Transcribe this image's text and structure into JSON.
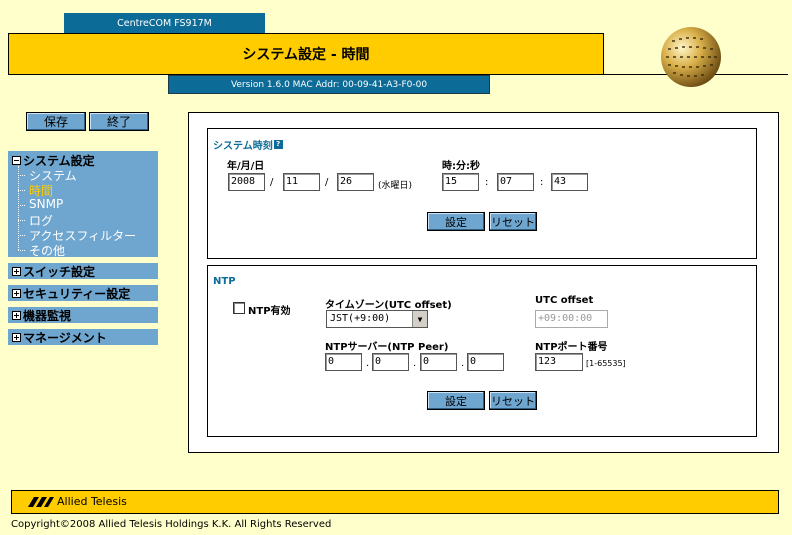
{
  "header": {
    "model": "CentreCOM FS917M",
    "title": "システム設定 - 時間",
    "version": "Version 1.6.0 MAC Addr: 00-09-41-A3-F0-00"
  },
  "sidebar": {
    "save_label": "保存",
    "exit_label": "終了",
    "system_settings": {
      "label": "システム設定",
      "items": [
        "システム",
        "時間",
        "SNMP",
        "ログ",
        "アクセスフィルター",
        "その他"
      ]
    },
    "categories": [
      "スイッチ設定",
      "セキュリティー設定",
      "機器監視",
      "マネージメント"
    ]
  },
  "system_time": {
    "title": "システム時刻",
    "date_label": "年/月/日",
    "time_label": "時:分:秒",
    "year": "2008",
    "month": "11",
    "day": "26",
    "weekday": "(水曜日)",
    "hour": "15",
    "minute": "07",
    "second": "43",
    "date_sep": "/",
    "time_sep": ":",
    "set_label": "設定",
    "reset_label": "リセット"
  },
  "ntp": {
    "title": "NTP",
    "enable_label": "NTP有効",
    "enabled": false,
    "timezone_label": "タイムゾーン(UTC offset)",
    "timezone_value": "JST(+9:00)",
    "utc_offset_label": "UTC offset",
    "utc_offset_value": "+09:00:00",
    "server_label": "NTPサーバー(NTP Peer)",
    "server_octets": [
      "0",
      "0",
      "0",
      "0"
    ],
    "ip_sep": ".",
    "port_label": "NTPポート番号",
    "port_value": "123",
    "port_range": "[1-65535]",
    "set_label": "設定",
    "reset_label": "リセット"
  },
  "footer": {
    "brand": "Allied Telesis",
    "copyright": "Copyright©2008 Allied Telesis Holdings K.K. All Rights Reserved"
  },
  "colors": {
    "background": "#ffffcc",
    "accent_yellow": "#ffcc00",
    "header_blue": "#0d6c97",
    "sidebar_blue": "#6fa6cf"
  }
}
